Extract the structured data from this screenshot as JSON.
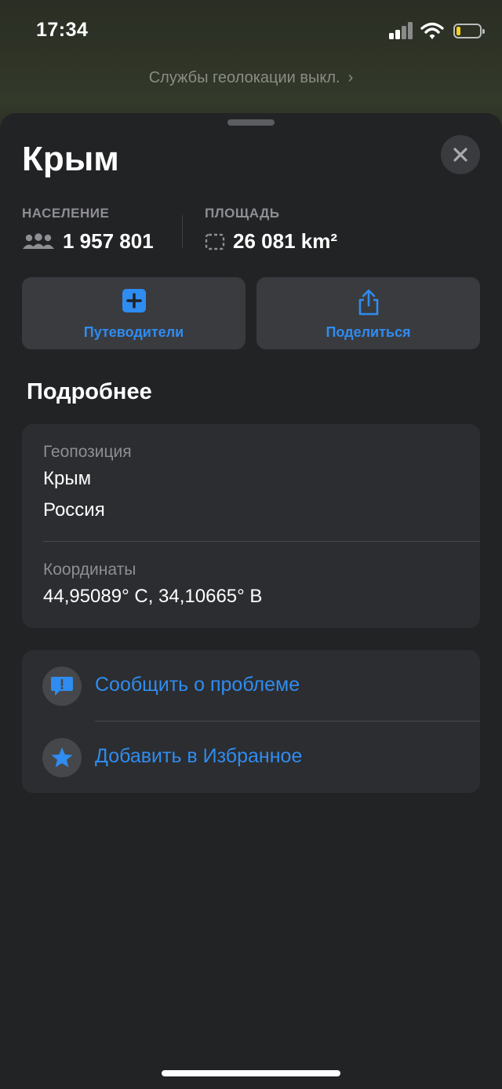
{
  "status_bar": {
    "time": "17:34"
  },
  "banner": {
    "text": "Службы геолокации выкл."
  },
  "place": {
    "title": "Крым",
    "population_label": "НАСЕЛЕНИЕ",
    "population_value": "1 957 801",
    "area_label": "ПЛОЩАДЬ",
    "area_value": "26 081 km²"
  },
  "actions": {
    "guides_label": "Путеводители",
    "share_label": "Поделиться"
  },
  "details": {
    "section_title": "Подробнее",
    "geo_label": "Геопозиция",
    "geo_line1": "Крым",
    "geo_line2": "Россия",
    "coords_label": "Координаты",
    "coords_value": "44,95089° С, 34,10665° В"
  },
  "links": {
    "report_label": "Сообщить о проблеме",
    "favorite_label": "Добавить в Избранное"
  },
  "colors": {
    "accent": "#2f8cf0",
    "sheet_bg": "#222325",
    "card_bg": "#2c2d30",
    "battery_level": "#f5d21b"
  }
}
